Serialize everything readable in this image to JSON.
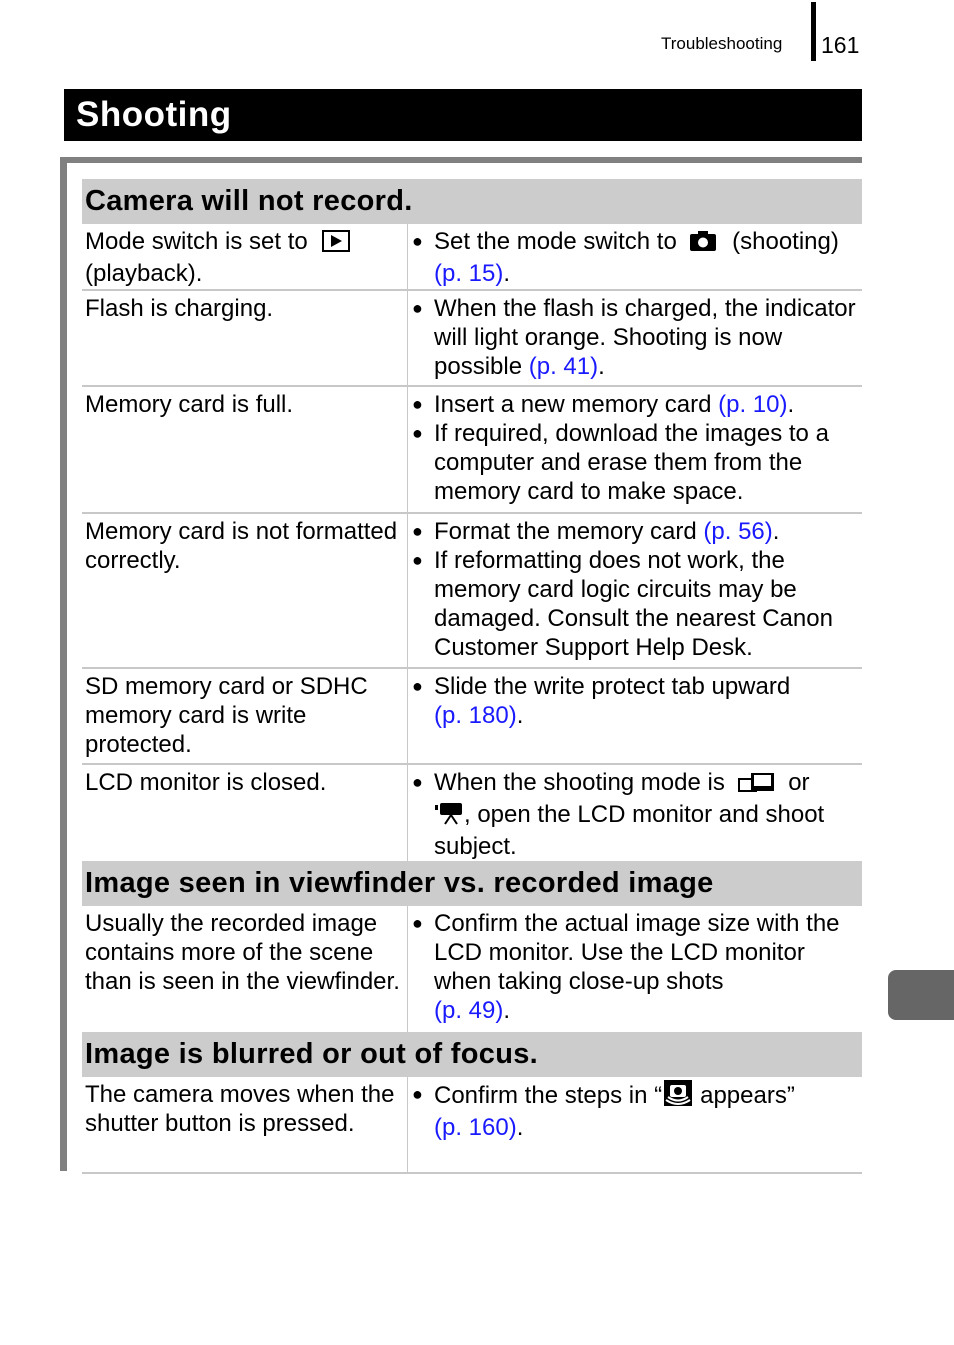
{
  "header": {
    "running_head": "Troubleshooting",
    "page_number": "161"
  },
  "section": {
    "title": "Shooting"
  },
  "colors": {
    "link": "#1a1aff",
    "category_bg": "#cccccc",
    "frame": "#808080",
    "side_tab": "#666666"
  },
  "groups": [
    {
      "title": "Camera will not record.",
      "rows": [
        {
          "cause_before": "Mode switch is set to",
          "cause_icon": "playback-icon",
          "cause_after": "(playback).",
          "solutions": [
            {
              "text_before": "Set the mode switch to",
              "icon": "camera-icon",
              "text_after": "(shooting)",
              "link": "(p. 15)",
              "end": "."
            }
          ]
        },
        {
          "cause": "Flash is charging.",
          "solutions": [
            {
              "text_before": "When the flash is charged, the indicator will light orange. Shooting is now possible",
              "link": "(p. 41)",
              "end": "."
            }
          ]
        },
        {
          "cause": "Memory card is full.",
          "solutions": [
            {
              "text_before": "Insert a new memory card",
              "link": "(p. 10)",
              "end": "."
            },
            {
              "text_before": "If required, download the images to a computer and erase them from the memory card to make space."
            }
          ]
        },
        {
          "cause": "Memory card is not formatted correctly.",
          "solutions": [
            {
              "text_before": "Format the memory card",
              "link": "(p. 56)",
              "end": "."
            },
            {
              "text_before": "If reformatting does not work, the memory card logic circuits may be damaged. Consult the nearest Canon Customer Support Help Desk."
            }
          ]
        },
        {
          "cause": "SD memory card or SDHC memory card is write protected.",
          "solutions": [
            {
              "text_before": "Slide the write protect tab upward",
              "link": "(p. 180)",
              "end": "."
            }
          ]
        },
        {
          "cause": "LCD monitor is closed.",
          "solutions": [
            {
              "text_before": "When the shooting mode is",
              "icon": "stitch-assist-icon",
              "text_mid": "or",
              "icon2": "movie-icon",
              "text_after": ", open the LCD monitor and shoot subject."
            }
          ]
        }
      ]
    },
    {
      "title": "Image seen in viewfinder vs. recorded image",
      "rows": [
        {
          "cause": "Usually the recorded image contains more of the scene than is seen in the viewfinder.",
          "solutions": [
            {
              "text_before": "Confirm the actual image size with the LCD monitor. Use the LCD monitor when taking close-up shots",
              "link": "(p. 49)",
              "end": "."
            }
          ]
        }
      ]
    },
    {
      "title": "Image is blurred or out of focus.",
      "rows": [
        {
          "cause": "The camera moves when the shutter button is pressed.",
          "solutions": [
            {
              "text_before": "Confirm the steps in “",
              "icon": "camera-shake-icon",
              "text_after": "appears”",
              "link": "(p. 160)",
              "end": "."
            }
          ]
        }
      ]
    }
  ]
}
